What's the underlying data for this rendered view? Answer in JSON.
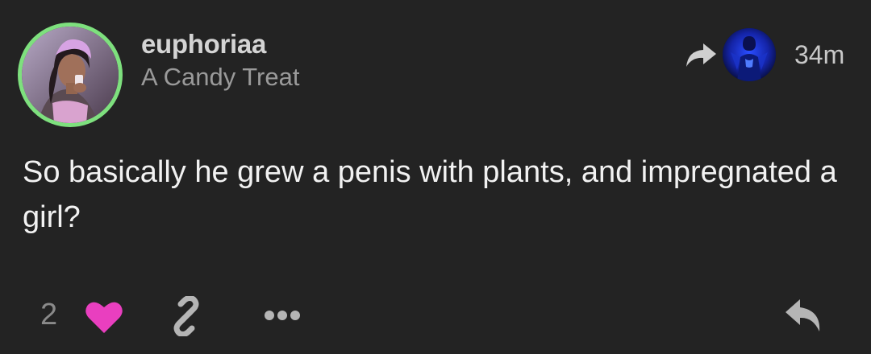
{
  "post": {
    "username": "euphoriaa",
    "subtitle": "A Candy Treat",
    "timestamp": "34m",
    "body": "So basically he grew a penis with plants, and impregnated a girl?",
    "like_count": "2"
  },
  "icons": {
    "share": "share-arrow-icon",
    "heart": "heart-icon",
    "link": "link-icon",
    "more": "more-dots-icon",
    "reply": "reply-icon"
  },
  "colors": {
    "background": "#232323",
    "avatar_ring": "#7ee07e",
    "heart": "#e93fbf",
    "username": "#d4d4d4",
    "subtitle": "#9a9a9a",
    "body_text": "#f2f2f2"
  }
}
